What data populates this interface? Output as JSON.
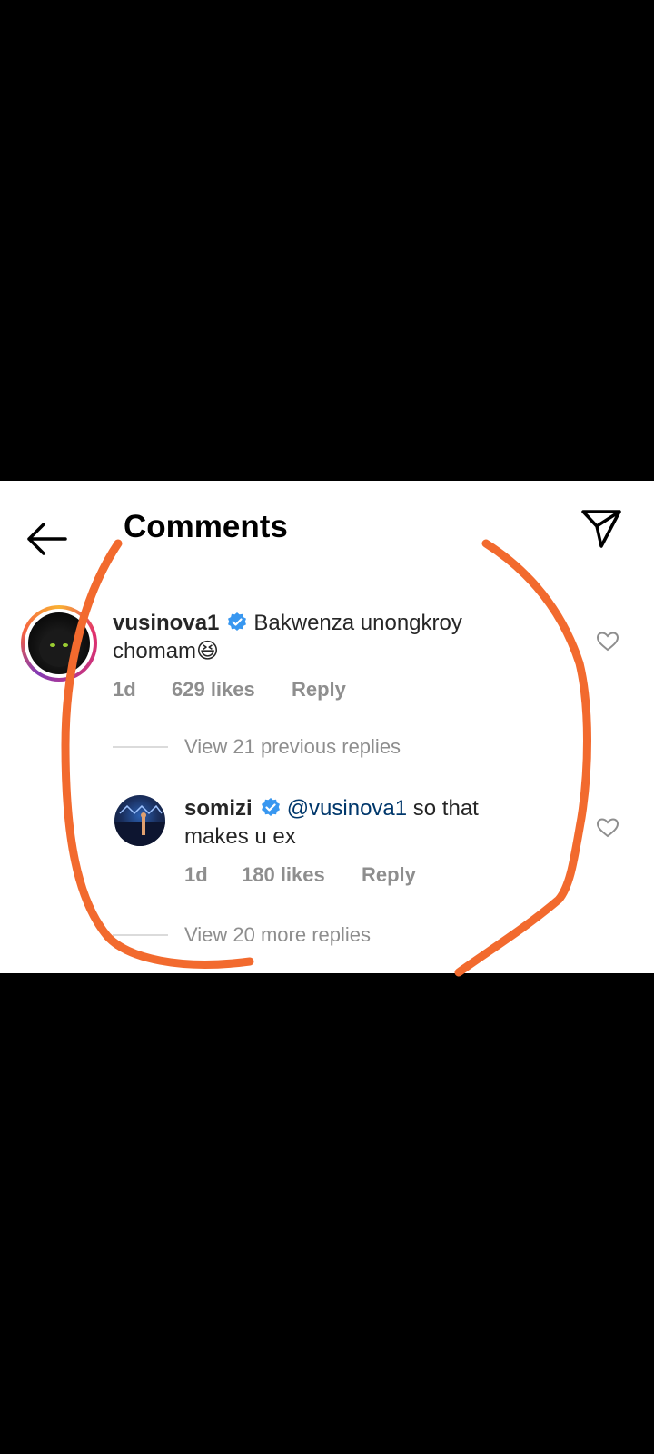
{
  "header": {
    "title": "Comments",
    "back_icon": "arrow-left-icon",
    "share_icon": "paper-plane-icon"
  },
  "comments": [
    {
      "username": "vusinova1",
      "verified": true,
      "text_line1": "Bakwenza unongkroy",
      "text_line2": "chomam😆",
      "time": "1d",
      "likes": "629 likes",
      "reply": "Reply",
      "view_replies": "View 21 previous replies"
    },
    {
      "username": "somizi",
      "verified": true,
      "mention": "@vusinova1",
      "text_line1_rest": " so that",
      "text_line2": "makes u ex",
      "time": "1d",
      "likes": "180 likes",
      "reply": "Reply",
      "view_replies": "View 20 more replies"
    }
  ],
  "colors": {
    "verified_blue": "#3897f0",
    "scribble_orange": "#f26a2e",
    "muted_text": "#8e8e8e",
    "mention_blue": "#00376b"
  }
}
